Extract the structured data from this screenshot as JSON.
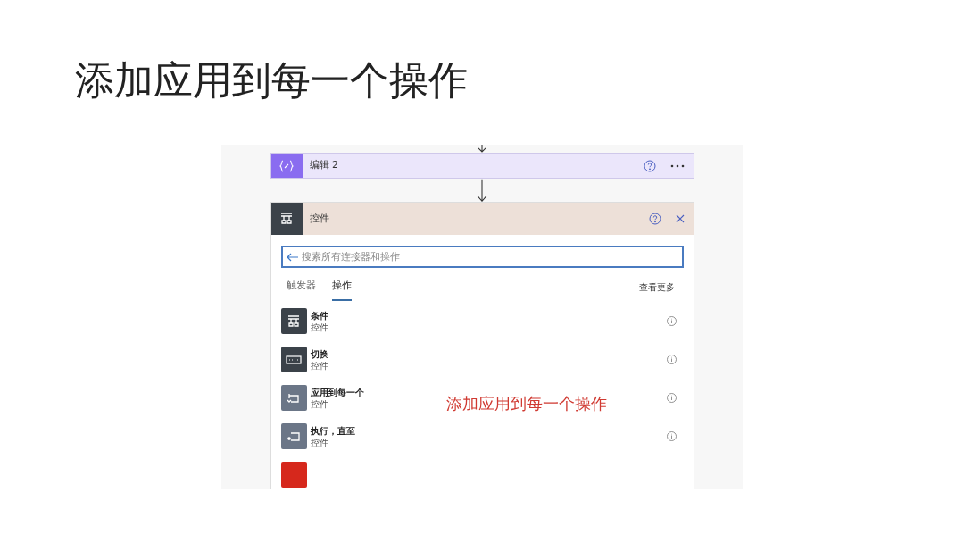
{
  "slide_title": "添加应用到每一个操作",
  "flow": {
    "step": {
      "title": "编辑 2"
    },
    "panel": {
      "title": "控件",
      "search": {
        "placeholder": "搜索所有连接器和操作"
      },
      "tabs": [
        {
          "label": "触发器",
          "selected": false
        },
        {
          "label": "操作",
          "selected": true
        }
      ],
      "see_more": "查看更多",
      "items": [
        {
          "kind": "condition",
          "title": "条件",
          "subtitle": "控件",
          "color": "#3b4249"
        },
        {
          "kind": "switch",
          "title": "切换",
          "subtitle": "控件",
          "color": "#3b4249"
        },
        {
          "kind": "foreach",
          "title": "应用到每一个",
          "subtitle": "控件",
          "color": "#6b7687"
        },
        {
          "kind": "until",
          "title": "执行，直至",
          "subtitle": "控件",
          "color": "#6b7687"
        },
        {
          "kind": "terminate",
          "color": "#d6281c"
        }
      ]
    },
    "annotation": "添加应用到每一个操作"
  }
}
